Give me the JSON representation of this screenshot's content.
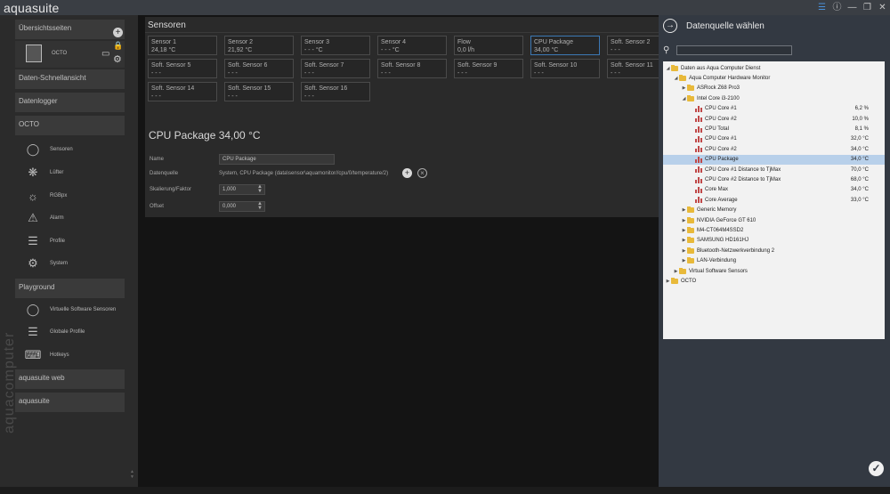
{
  "app": {
    "title": "aquasuite"
  },
  "window": {
    "controls": [
      "layers",
      "info",
      "minimize",
      "restore",
      "close"
    ]
  },
  "sidebar": {
    "overview_label": "Übersichtsseiten",
    "device_name": "OCTO",
    "sections": {
      "quick_view": "Daten-Schnellansicht",
      "datalogger": "Datenlogger",
      "octo": "OCTO",
      "playground": "Playground",
      "web": "aquasuite web",
      "suite": "aquasuite"
    },
    "octo_items": [
      {
        "label": "Sensoren",
        "icon": "gauge-icon"
      },
      {
        "label": "Lüfter",
        "icon": "fan-icon"
      },
      {
        "label": "RGBpx",
        "icon": "bulb-icon"
      },
      {
        "label": "Alarm",
        "icon": "alarm-icon"
      },
      {
        "label": "Profile",
        "icon": "layers-icon"
      },
      {
        "label": "System",
        "icon": "gear-icon"
      }
    ],
    "playground_items": [
      {
        "label": "Virtuelle Software Sensoren",
        "icon": "gauge-icon"
      },
      {
        "label": "Globale Profile",
        "icon": "layers-icon"
      },
      {
        "label": "Hotkeys",
        "icon": "keyboard-icon"
      }
    ],
    "vertical_logo": "aquacomputer"
  },
  "main": {
    "sensors_title": "Sensoren",
    "tiles": [
      {
        "name": "Sensor 1",
        "value": "24,18 °C"
      },
      {
        "name": "Sensor 2",
        "value": "21,92 °C"
      },
      {
        "name": "Sensor 3",
        "value": "- - - °C"
      },
      {
        "name": "Sensor 4",
        "value": "- - - °C"
      },
      {
        "name": "Flow",
        "value": "0,0 l/h"
      },
      {
        "name": "CPU Package",
        "value": "34,00 °C"
      },
      {
        "name": "Soft. Sensor 2",
        "value": "- - -"
      },
      {
        "name": "Soft. Sensor 5",
        "value": "- - -"
      },
      {
        "name": "Soft. Sensor 6",
        "value": "- - -"
      },
      {
        "name": "Soft. Sensor 7",
        "value": "- - -"
      },
      {
        "name": "Soft. Sensor 8",
        "value": "- - -"
      },
      {
        "name": "Soft. Sensor 9",
        "value": "- - -"
      },
      {
        "name": "Soft. Sensor 10",
        "value": "- - -"
      },
      {
        "name": "Soft. Sensor 11",
        "value": "- - -"
      },
      {
        "name": "Soft. Sensor 14",
        "value": "- - -"
      },
      {
        "name": "Soft. Sensor 15",
        "value": "- - -"
      },
      {
        "name": "Soft. Sensor 16",
        "value": "- - -"
      }
    ],
    "detail": {
      "title": "CPU Package   34,00 °C",
      "name_label": "Name",
      "name_value": "CPU Package",
      "source_label": "Datenquelle",
      "source_value": "System, CPU Package (data\\sensor\\aquamonitor//cpu/0/temperature/2)",
      "scale_label": "Skalierung/Faktor",
      "scale_value": "1,000",
      "offset_label": "Offset",
      "offset_value": "0,000"
    }
  },
  "panel": {
    "title": "Datenquelle wählen",
    "search_placeholder": "",
    "tree": [
      {
        "label": "Daten aus Aqua Computer Dienst",
        "value": "",
        "kind": "folder",
        "expanded": true
      },
      {
        "label": "Aqua Computer Hardware Monitor",
        "value": "",
        "kind": "folder",
        "expanded": true
      },
      {
        "label": "ASRock Z68 Pro3",
        "value": "",
        "kind": "folder",
        "expanded": false
      },
      {
        "label": "Intel Core i3-2100",
        "value": "",
        "kind": "folder",
        "expanded": true
      },
      {
        "label": "CPU Core #1",
        "value": "6,2 %",
        "kind": "sensor"
      },
      {
        "label": "CPU Core #2",
        "value": "10,0 %",
        "kind": "sensor"
      },
      {
        "label": "CPU Total",
        "value": "8,1 %",
        "kind": "sensor"
      },
      {
        "label": "CPU Core #1",
        "value": "32,0 °C",
        "kind": "sensor"
      },
      {
        "label": "CPU Core #2",
        "value": "34,0 °C",
        "kind": "sensor"
      },
      {
        "label": "CPU Package",
        "value": "34,0 °C",
        "kind": "sensor",
        "selected": true
      },
      {
        "label": "CPU Core #1 Distance to TjMax",
        "value": "70,0 °C",
        "kind": "sensor"
      },
      {
        "label": "CPU Core #2 Distance to TjMax",
        "value": "68,0 °C",
        "kind": "sensor"
      },
      {
        "label": "Core Max",
        "value": "34,0 °C",
        "kind": "sensor"
      },
      {
        "label": "Core Average",
        "value": "33,0 °C",
        "kind": "sensor"
      },
      {
        "label": "Generic Memory",
        "value": "",
        "kind": "folder",
        "expanded": false
      },
      {
        "label": "NVIDIA GeForce GT 610",
        "value": "",
        "kind": "folder",
        "expanded": false
      },
      {
        "label": "M4-CT064M4SSD2",
        "value": "",
        "kind": "folder",
        "expanded": false
      },
      {
        "label": "SAMSUNG HD161HJ",
        "value": "",
        "kind": "folder",
        "expanded": false
      },
      {
        "label": "Bluetooth-Netzwerkverbindung 2",
        "value": "",
        "kind": "folder",
        "expanded": false
      },
      {
        "label": "LAN-Verbindung",
        "value": "",
        "kind": "folder",
        "expanded": false
      },
      {
        "label": "Virtual Software Sensors",
        "value": "",
        "kind": "folder",
        "expanded": false
      },
      {
        "label": "OCTO",
        "value": "",
        "kind": "folder",
        "expanded": false
      }
    ]
  },
  "colors": {
    "accent": "#3c78b4",
    "selection": "#b8d0ea",
    "folder": "#e8b93a",
    "panel_bg": "#333942"
  }
}
